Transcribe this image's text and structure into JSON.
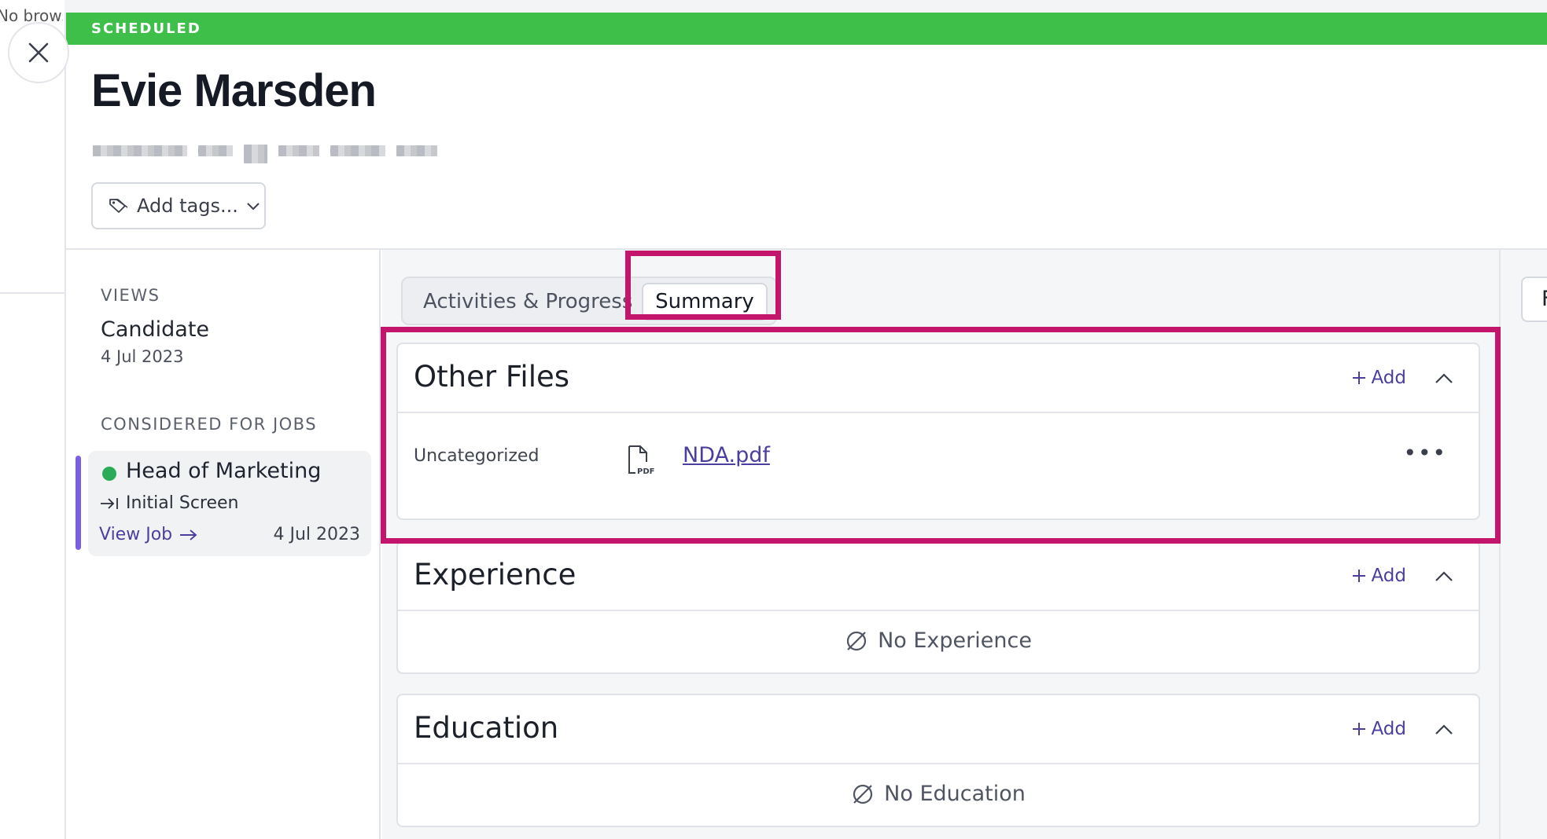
{
  "background": {
    "partial_text": "No browse"
  },
  "status": {
    "label": "SCHEDULED",
    "color": "#3dbf4a"
  },
  "candidate": {
    "name": "Evie Marsden"
  },
  "tags": {
    "button_label": "Add tags..."
  },
  "sidebar": {
    "views_heading": "VIEWS",
    "view": {
      "title": "Candidate",
      "date": "4 Jul 2023"
    },
    "jobs_heading": "CONSIDERED FOR JOBS",
    "job": {
      "title": "Head of Marketing",
      "stage": "Initial Screen",
      "link_label": "View Job",
      "date": "4 Jul 2023"
    }
  },
  "tabs": {
    "activities_label": "Activities & Progress",
    "summary_label": "Summary",
    "active": "Summary"
  },
  "right_rail": {
    "tab_label": "F"
  },
  "sections": {
    "other_files": {
      "title": "Other Files",
      "add_label": "Add",
      "file": {
        "category": "Uncategorized",
        "name": "NDA.pdf",
        "type_badge": "PDF"
      }
    },
    "experience": {
      "title": "Experience",
      "add_label": "Add",
      "empty_text": "No Experience"
    },
    "education": {
      "title": "Education",
      "add_label": "Add",
      "empty_text": "No Education"
    }
  },
  "colors": {
    "accent": "#4b3f9e",
    "highlight": "#c4156d",
    "job_status_dot": "#2bab57",
    "job_accent": "#7a5fe0"
  },
  "icons": [
    "close-icon",
    "tag-icon",
    "chevron-down-icon",
    "arrow-to-line-icon",
    "arrow-right-icon",
    "plus-icon",
    "chevron-up-icon",
    "pdf-file-icon",
    "more-icon",
    "no-entry-icon"
  ]
}
